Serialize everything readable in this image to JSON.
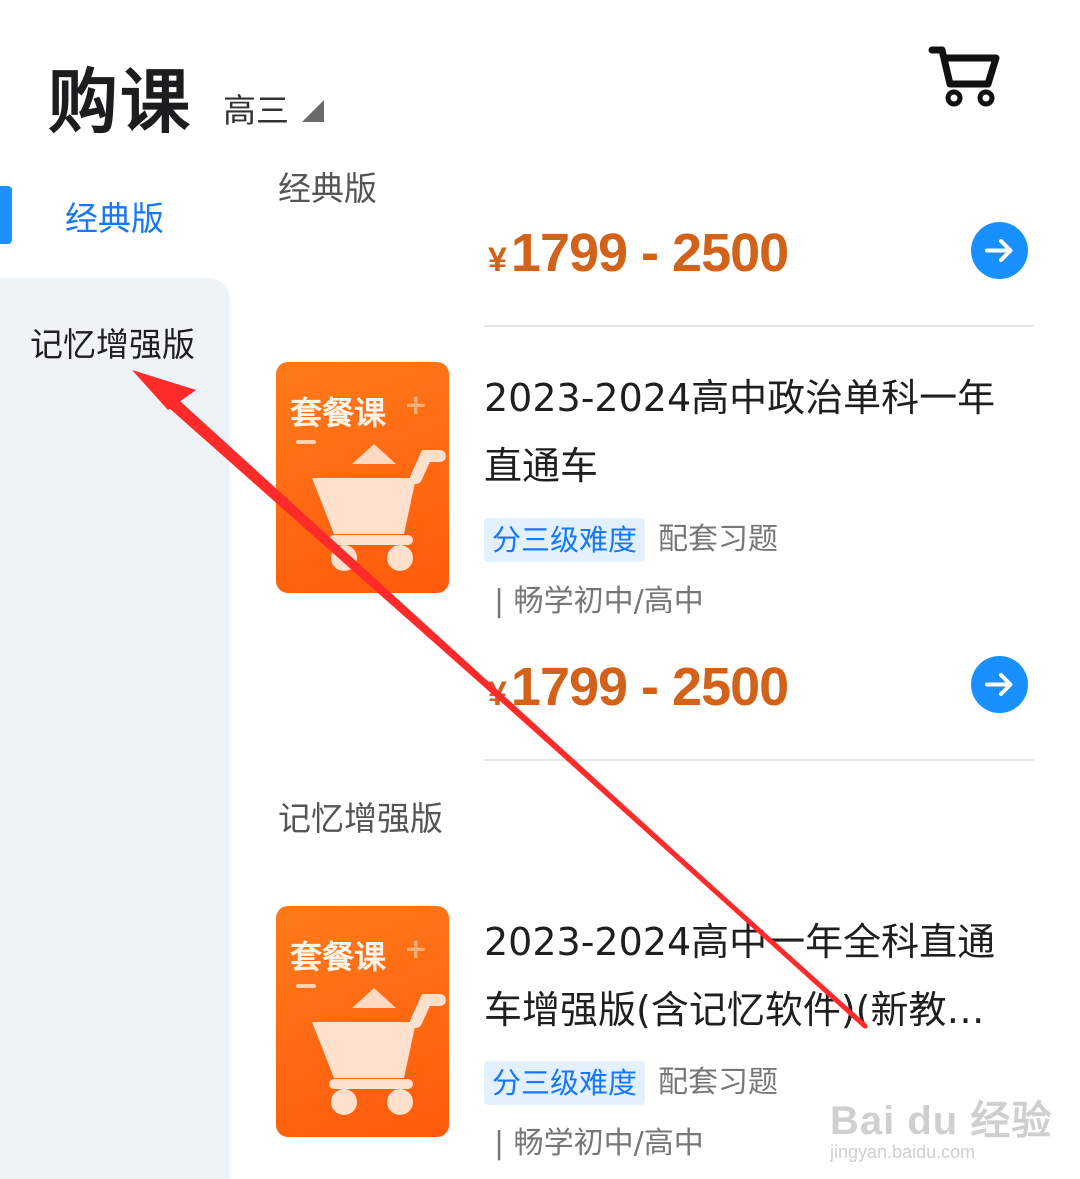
{
  "header": {
    "title": "购课",
    "grade": "高三"
  },
  "sidebar": {
    "items": [
      {
        "label": "经典版",
        "active": true
      },
      {
        "label": "记忆增强版",
        "active": false
      }
    ]
  },
  "sections": [
    {
      "title": "经典版",
      "top_price": {
        "yen": "¥",
        "range": "1799 - 2500"
      },
      "course": {
        "thumb_tag": "套餐课",
        "name": "2023-2024高中政治单科一年直通车",
        "tag": "分三级难度",
        "extra": "配套习题",
        "provider": "| 畅学初中/高中",
        "price": {
          "yen": "¥",
          "range": "1799 - 2500"
        }
      }
    },
    {
      "title": "记忆增强版",
      "course": {
        "thumb_tag": "套餐课",
        "name": "2023-2024高中一年全科直通车增强版(含记忆软件)(新教…",
        "tag": "分三级难度",
        "extra": "配套习题",
        "provider": "| 畅学初中/高中"
      }
    }
  ],
  "watermark": {
    "brand": "Bai du 经验",
    "url": "jingyan.baidu.com"
  },
  "colors": {
    "accent": "#1890ff",
    "price": "#d2611a",
    "annotation_arrow": "#ff2a2a"
  },
  "icons": [
    "cart-icon",
    "caret-down-icon",
    "arrow-right-icon"
  ]
}
